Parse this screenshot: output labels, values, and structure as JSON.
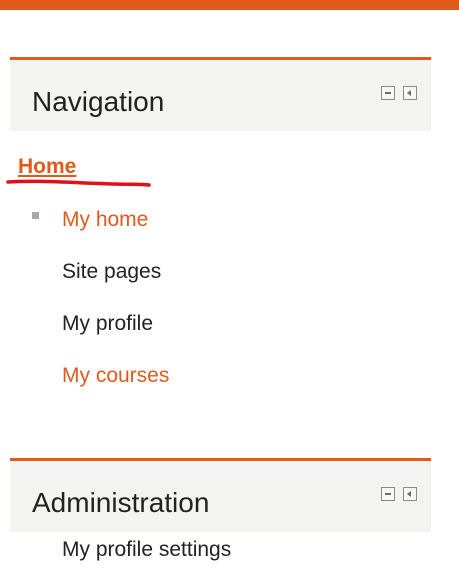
{
  "colors": {
    "accent": "#e05a1c",
    "annotation": "#e0101a"
  },
  "navigation_block": {
    "title": "Navigation",
    "controls": [
      "collapse-icon",
      "dock-icon"
    ],
    "home_link": "Home",
    "items": [
      {
        "label": "My home",
        "style": "link",
        "bullet": true
      },
      {
        "label": "Site pages",
        "style": "plain"
      },
      {
        "label": "My profile",
        "style": "plain"
      },
      {
        "label": "My courses",
        "style": "link"
      }
    ]
  },
  "administration_block": {
    "title": "Administration",
    "controls": [
      "collapse-icon",
      "dock-icon"
    ],
    "items": [
      {
        "label": "My profile settings"
      }
    ]
  }
}
